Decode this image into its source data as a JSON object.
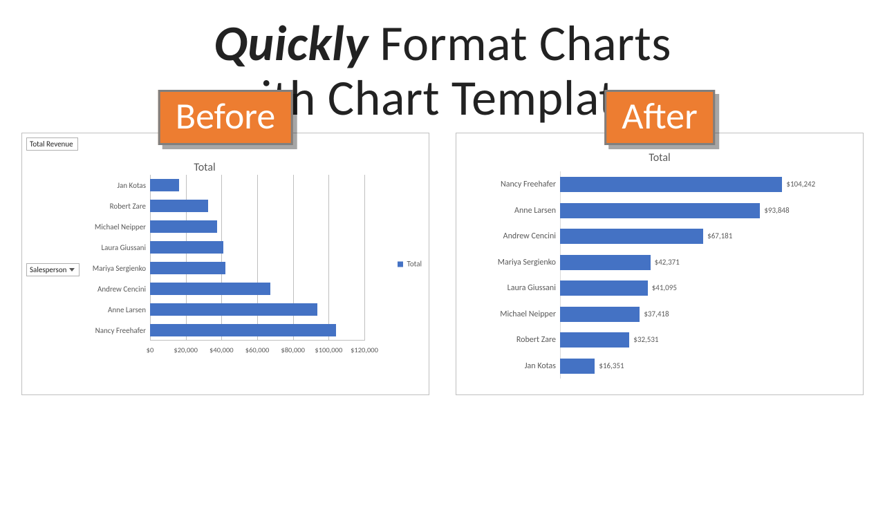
{
  "headline": {
    "emph": "Quickly",
    "rest1": " Format Charts",
    "rest2": "with Chart Templates"
  },
  "badges": {
    "before": "Before",
    "after": "After"
  },
  "pivot": {
    "value_field": "Total Revenue",
    "axis_field": "Salesperson"
  },
  "legend": {
    "series": "Total"
  },
  "chart_data": [
    {
      "id": "before",
      "type": "bar",
      "orientation": "horizontal",
      "title": "Total",
      "xlabel": "",
      "ylabel": "",
      "xlim": [
        0,
        120000
      ],
      "xticks": [
        0,
        20000,
        40000,
        60000,
        80000,
        100000,
        120000
      ],
      "xtick_labels": [
        "$0",
        "$20,000",
        "$40,000",
        "$60,000",
        "$80,000",
        "$100,000",
        "$120,000"
      ],
      "categories": [
        "Jan Kotas",
        "Robert Zare",
        "Michael Neipper",
        "Laura Giussani",
        "Mariya Sergienko",
        "Andrew Cencini",
        "Anne Larsen",
        "Nancy Freehafer"
      ],
      "values": [
        16351,
        32531,
        37418,
        41095,
        42371,
        67181,
        93848,
        104242
      ],
      "series_name": "Total",
      "grid": true,
      "data_labels": false,
      "legend_position": "right"
    },
    {
      "id": "after",
      "type": "bar",
      "orientation": "horizontal",
      "title": "Total",
      "xlabel": "",
      "ylabel": "",
      "xlim": [
        0,
        120000
      ],
      "categories": [
        "Nancy Freehafer",
        "Anne Larsen",
        "Andrew Cencini",
        "Mariya Sergienko",
        "Laura Giussani",
        "Michael Neipper",
        "Robert Zare",
        "Jan Kotas"
      ],
      "values": [
        104242,
        93848,
        67181,
        42371,
        41095,
        37418,
        32531,
        16351
      ],
      "value_labels": [
        "$104,242",
        "$93,848",
        "$67,181",
        "$42,371",
        "$41,095",
        "$37,418",
        "$32,531",
        "$16,351"
      ],
      "series_name": "Total",
      "grid": false,
      "data_labels": true,
      "legend_position": "none"
    }
  ],
  "colors": {
    "bar": "#4472C4",
    "badge": "#ED7D31"
  }
}
